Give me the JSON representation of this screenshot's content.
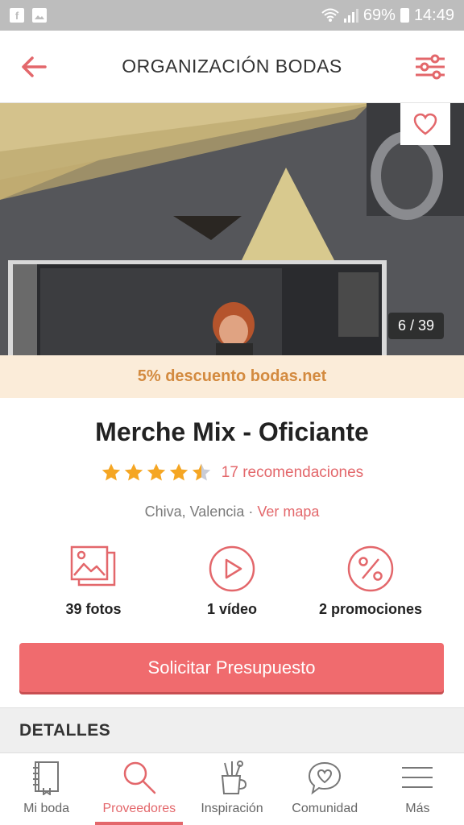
{
  "status_bar": {
    "battery": "69%",
    "time": "14:49",
    "icons": [
      "facebook-icon",
      "image-icon",
      "wifi-icon",
      "signal-icon",
      "battery-icon"
    ]
  },
  "header": {
    "title": "ORGANIZACIÓN BODAS",
    "back_icon": "arrow-left-icon",
    "filter_icon": "sliders-icon"
  },
  "hero": {
    "photo_counter": "6 / 39",
    "favorite_icon": "heart-icon"
  },
  "discount": {
    "text": "5% descuento bodas.net"
  },
  "vendor": {
    "name": "Merche Mix - Oficiante",
    "rating": 4.5,
    "rating_max": 5,
    "recommendations": "17 recomendaciones",
    "location": "Chiva, Valencia · ",
    "map_link": "Ver mapa"
  },
  "media": [
    {
      "label": "39 fotos",
      "icon": "photos-icon"
    },
    {
      "label": "1 vídeo",
      "icon": "play-icon"
    },
    {
      "label": "2 promociones",
      "icon": "percent-icon"
    }
  ],
  "cta": {
    "label": "Solicitar Presupuesto"
  },
  "details": {
    "title": "DETALLES"
  },
  "bottom_nav": {
    "items": [
      {
        "label": "Mi boda",
        "icon": "notebook-icon",
        "active": false
      },
      {
        "label": "Proveedores",
        "icon": "search-icon",
        "active": true
      },
      {
        "label": "Inspiración",
        "icon": "brushes-icon",
        "active": false
      },
      {
        "label": "Comunidad",
        "icon": "chat-heart-icon",
        "active": false
      },
      {
        "label": "Más",
        "icon": "menu-icon",
        "active": false
      }
    ]
  },
  "colors": {
    "accent": "#e3676b",
    "cta": "#f06b6e",
    "discount_bg": "#fbecd9",
    "discount_text": "#d38a3f",
    "star": "#f5a623"
  }
}
